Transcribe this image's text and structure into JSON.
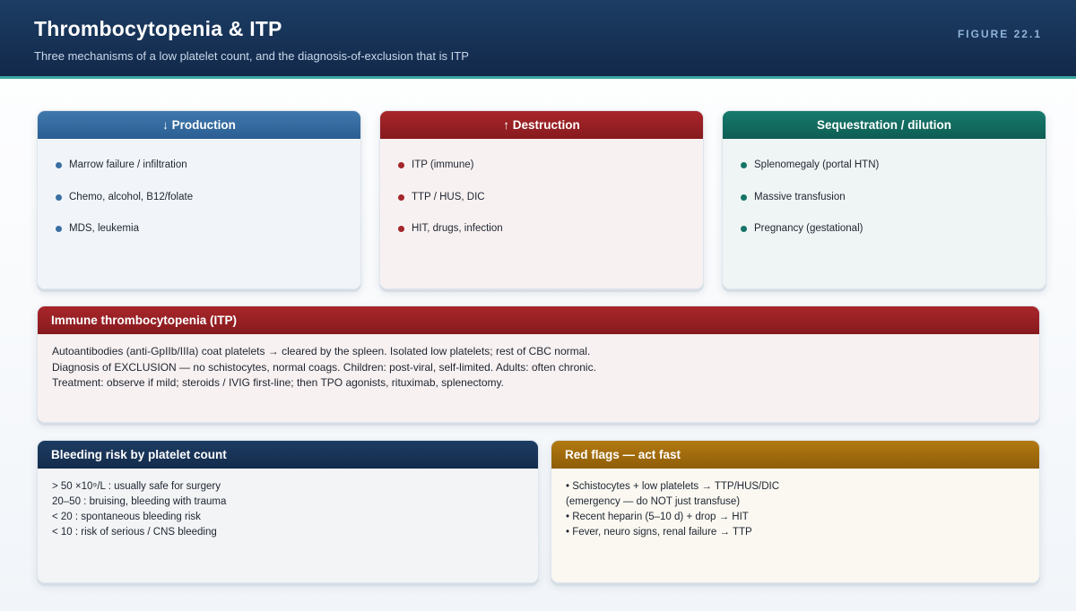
{
  "header": {
    "title": "Thrombocytopenia & ITP",
    "subtitle": "Three mechanisms of a low platelet count, and the diagnosis-of-exclusion that is ITP",
    "figure_label": "FIGURE 22.1"
  },
  "mechanisms": [
    {
      "title": "↓ Production",
      "items": [
        "Marrow failure / infiltration",
        "Chemo, alcohol, B12/folate",
        "MDS, leukemia"
      ]
    },
    {
      "title": "↑ Destruction",
      "items": [
        "ITP (immune)",
        "TTP / HUS, DIC",
        "HIT, drugs, infection"
      ]
    },
    {
      "title": "Sequestration / dilution",
      "items": [
        "Splenomegaly (portal HTN)",
        "Massive transfusion",
        "Pregnancy (gestational)"
      ]
    }
  ],
  "itp": {
    "title": "Immune thrombocytopenia (ITP)",
    "lines": [
      "Autoantibodies (anti-GpIIb/IIIa) coat platelets → cleared by the spleen. Isolated low platelets; rest of CBC normal.",
      "Diagnosis of EXCLUSION — no schistocytes, normal coags. Children: post-viral, self-limited. Adults: often chronic.",
      "Treatment: observe if mild; steroids / IVIG first-line; then TPO agonists, rituximab, splenectomy."
    ]
  },
  "bleeding": {
    "title": "Bleeding risk by platelet count",
    "lines": [
      "> 50 ×10⁹/L : usually safe for surgery",
      "20–50 : bruising, bleeding with trauma",
      "< 20 : spontaneous bleeding risk",
      "< 10 : risk of serious / CNS bleeding"
    ]
  },
  "red_flags": {
    "title": "Red flags — act fast",
    "lines": [
      "• Schistocytes + low platelets → TTP/HUS/DIC",
      "(emergency — do NOT just transfuse)",
      "• Recent heparin (5–10 d) + drop → HIT",
      "• Fever, neuro signs, renal failure → TTP"
    ]
  },
  "colors": {
    "production": "#2b5e92",
    "destruction": "#861a1e",
    "sequestration": "#0e5d53",
    "bleeding": "#142c4c",
    "red_flags": "#8f5d08"
  }
}
